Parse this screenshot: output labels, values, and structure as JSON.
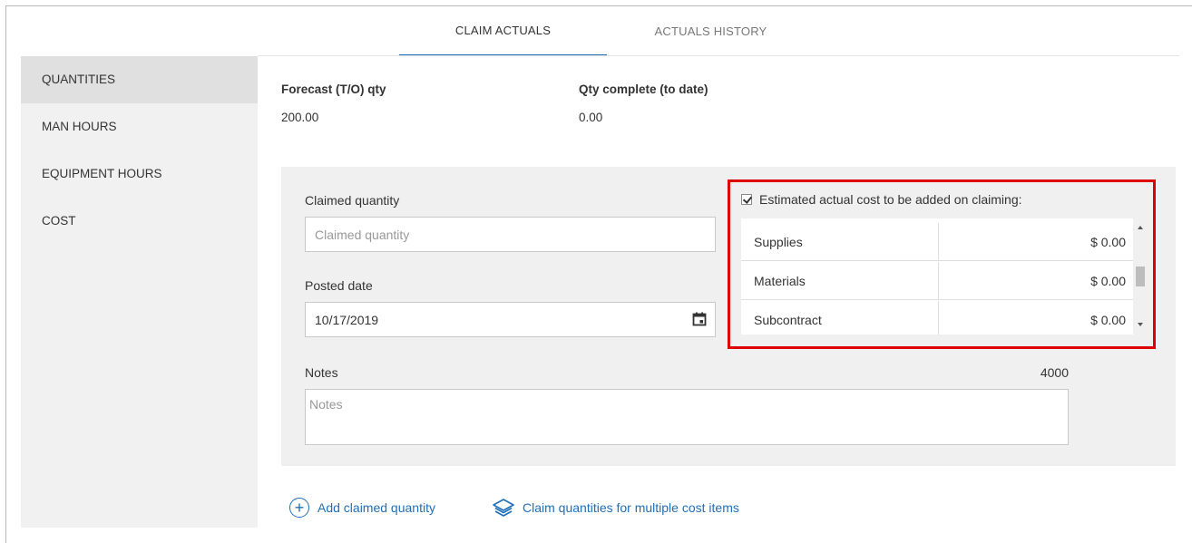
{
  "tabs": [
    {
      "label": "CLAIM ACTUALS",
      "active": true
    },
    {
      "label": "ACTUALS HISTORY",
      "active": false
    }
  ],
  "sidebar": {
    "items": [
      {
        "label": "QUANTITIES",
        "active": true
      },
      {
        "label": "MAN HOURS",
        "active": false
      },
      {
        "label": "EQUIPMENT HOURS",
        "active": false
      },
      {
        "label": "COST",
        "active": false
      }
    ]
  },
  "summary": {
    "forecast_label": "Forecast (T/O) qty",
    "forecast_value": "200.00",
    "complete_label": "Qty complete (to date)",
    "complete_value": "0.00"
  },
  "form": {
    "claimed_quantity_label": "Claimed quantity",
    "claimed_quantity_placeholder": "Claimed quantity",
    "claimed_quantity_value": "",
    "posted_date_label": "Posted date",
    "posted_date_value": "10/17/2019",
    "notes_label": "Notes",
    "notes_placeholder": "Notes",
    "notes_value": "",
    "notes_counter": "4000"
  },
  "cost": {
    "checkbox_label": "Estimated actual cost to be added on claiming:",
    "checked": true,
    "rows": [
      {
        "name": "Supplies",
        "value": "$ 0.00"
      },
      {
        "name": "Materials",
        "value": "$ 0.00"
      },
      {
        "name": "Subcontract",
        "value": "$ 0.00"
      }
    ]
  },
  "actions": {
    "add_claimed_quantity": "Add claimed quantity",
    "claim_multiple": "Claim quantities for multiple cost items"
  },
  "colors": {
    "accent": "#1f6fb8",
    "highlight_border": "#e00000",
    "panel_bg": "#f0f0f0",
    "sidebar_bg": "#f1f1f1"
  },
  "icons": {
    "calendar": "calendar-icon",
    "add": "plus-circle-icon",
    "multiple": "layers-icon",
    "scroll_up": "scroll-up-arrow-icon",
    "scroll_down": "scroll-down-arrow-icon"
  }
}
